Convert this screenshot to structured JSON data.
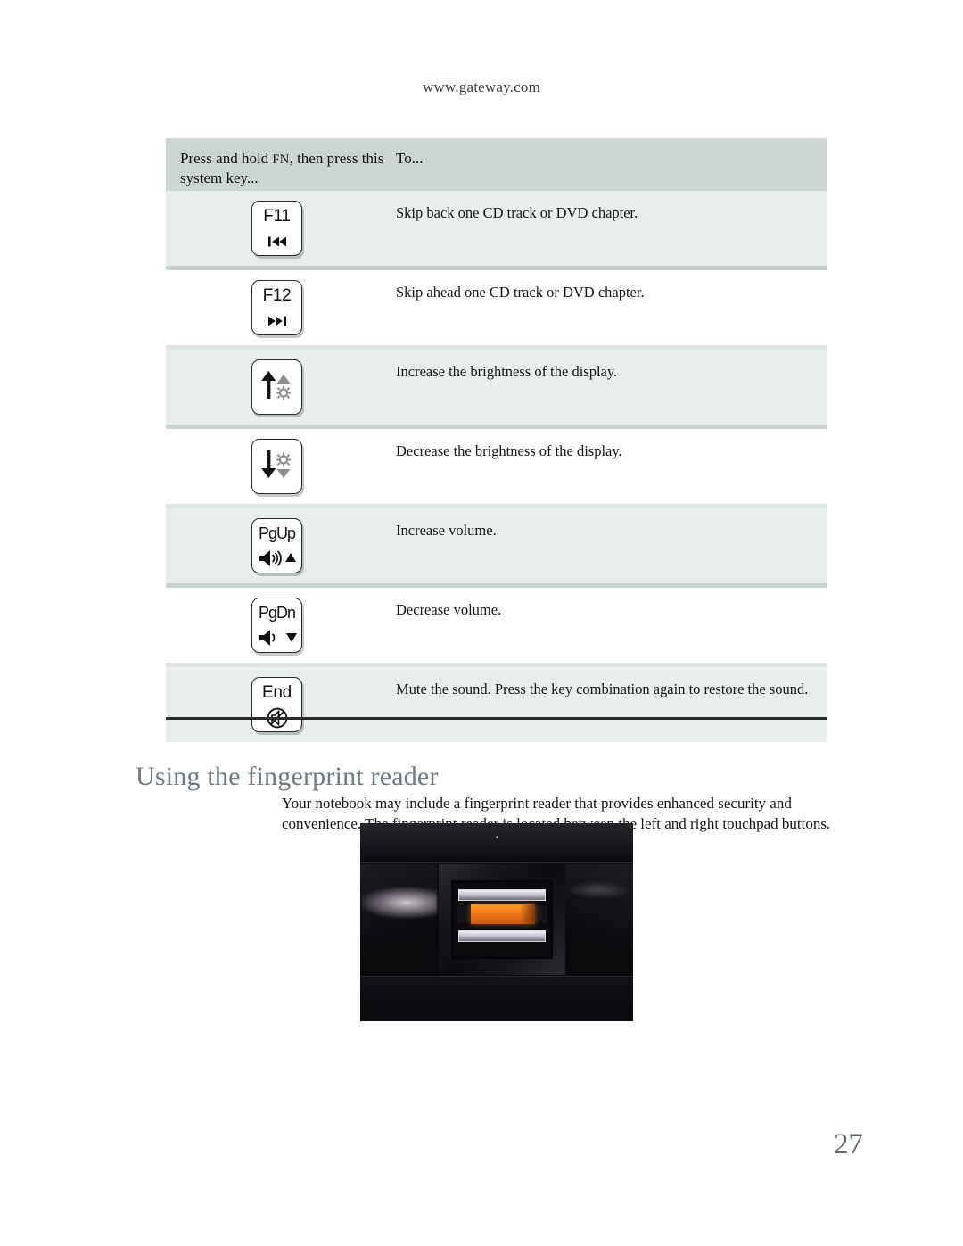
{
  "header": {
    "url": "www.gateway.com"
  },
  "table": {
    "columns": {
      "key_header_line1": "Press and hold FN, then press this",
      "key_header_line1_prefix": "Press and hold ",
      "key_header_fn": "FN",
      "key_header_line1_suffix": ", then press this",
      "key_header_line2": "system key...",
      "desc_header": "To..."
    },
    "rows": [
      {
        "key_label": "F11",
        "key_icon": "skip-back-icon",
        "description": "Skip back one CD track or DVD chapter."
      },
      {
        "key_label": "F12",
        "key_icon": "skip-forward-icon",
        "description": "Skip ahead one CD track or DVD chapter."
      },
      {
        "key_label": "",
        "key_icon": "brightness-up-icon",
        "description": "Increase the brightness of the display."
      },
      {
        "key_label": "",
        "key_icon": "brightness-down-icon",
        "description": "Decrease the brightness of the display."
      },
      {
        "key_label": "PgUp",
        "key_icon": "volume-up-icon",
        "description": "Increase volume."
      },
      {
        "key_label": "PgDn",
        "key_icon": "volume-down-icon",
        "description": "Decrease volume."
      },
      {
        "key_label": "End",
        "key_icon": "mute-icon",
        "description": "Mute the sound. Press the key combination again to restore the sound."
      }
    ]
  },
  "section": {
    "heading": "Using the fingerprint reader",
    "paragraph": "Your notebook may include a fingerprint reader that provides enhanced security and convenience. The fingerprint reader is located between the left and right touchpad buttons.",
    "figure_name": "fingerprint-reader-photo"
  },
  "footer": {
    "page_number": "27"
  },
  "colors": {
    "table_header_bg": "#ccd5d4",
    "table_row_alt_bg": "#e9edec",
    "table_row_bg": "#ffffff",
    "row_separator": "#c9d2d1",
    "heading_color": "#6f7b80",
    "page_number_color": "#5c6569",
    "sensor_orange": "#f0781a"
  }
}
